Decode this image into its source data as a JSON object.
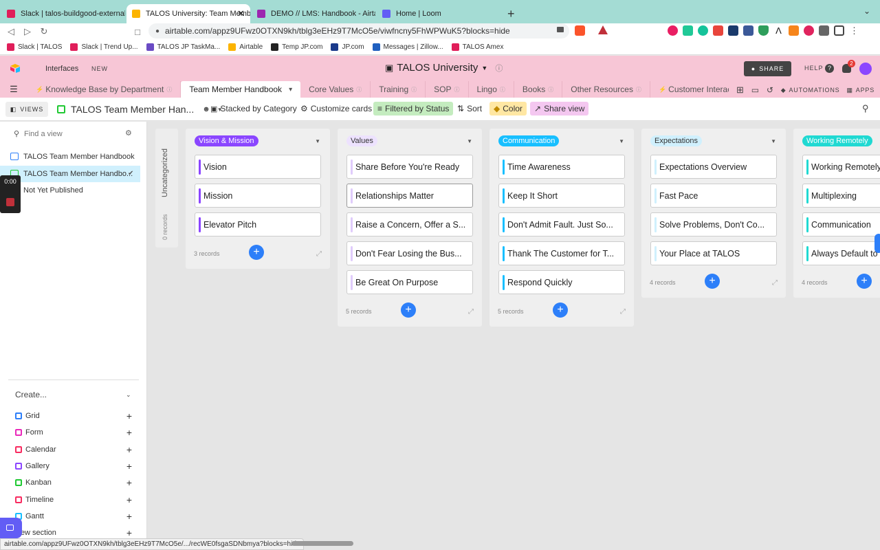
{
  "browser": {
    "tabs": [
      {
        "title": "Slack | talos-buildgood-external | T",
        "color": "#e01e5a"
      },
      {
        "title": "TALOS University: Team Membe",
        "color": "#fcb400"
      },
      {
        "title": "DEMO // LMS: Handbook - Airtable",
        "color": "#9c27b0"
      },
      {
        "title": "Home | Loom",
        "color": "#625df5"
      }
    ],
    "url": "airtable.com/appz9UFwz0OTXN9kh/tblg3eEHz9T7McO5e/viwfncny5FhWPWuK5?blocks=hide",
    "bookmarks": [
      "Slack | TALOS",
      "Slack | Trend Up...",
      "TALOS JP TaskMa...",
      "Airtable",
      "Temp JP.com",
      "JP.com",
      "Messages | Zillow...",
      "TALOS Amex"
    ],
    "status_url": "airtable.com/appz9UFwz0OTXN9kh/tblg3eEHz9T7McO5e/.../recWE0fsgaSDNbmya?blocks=hide"
  },
  "app": {
    "interfaces_label": "Interfaces",
    "new_badge": "NEW",
    "base_title": "TALOS University",
    "share_label": "SHARE",
    "help_label": "HELP",
    "notif_count": "2",
    "automations_label": "AUTOMATIONS",
    "apps_label": "APPS"
  },
  "tables": [
    "Knowledge Base by Department",
    "Team Member Handbook",
    "Core Values",
    "Training",
    "SOP",
    "Lingo",
    "Books",
    "Other Resources",
    "Customer Interactio"
  ],
  "toolbar": {
    "views_label": "VIEWS",
    "view_name": "TALOS Team Member Han...",
    "stacked": "Stacked by Category",
    "customize": "Customize cards",
    "filtered": "Filtered by Status",
    "sort": "Sort",
    "color": "Color",
    "share_view": "Share view"
  },
  "sidebar": {
    "find_placeholder": "Find a view",
    "views": [
      "TALOS Team Member Handbook",
      "TALOS Team Member Handbo...",
      "Not Yet Published"
    ],
    "create_label": "Create...",
    "create_items": [
      {
        "label": "Grid",
        "color": "#2d7ff9"
      },
      {
        "label": "Form",
        "color": "#e929ba"
      },
      {
        "label": "Calendar",
        "color": "#f82b60"
      },
      {
        "label": "Gallery",
        "color": "#8b46ff"
      },
      {
        "label": "Kanban",
        "color": "#20c933"
      },
      {
        "label": "Timeline",
        "color": "#f82b60"
      },
      {
        "label": "Gantt",
        "color": "#18bfff"
      },
      {
        "label": "New section",
        "color": ""
      }
    ],
    "recorder_time": "0:00"
  },
  "board": {
    "uncategorized_label": "Uncategorized",
    "uncategorized_count": "0 records",
    "columns": [
      {
        "name": "Vision & Mission",
        "pill_bg": "#8b46ff",
        "pill_fg": "#ffffff",
        "bar": "#8b46ff",
        "count": "3 records",
        "cards": [
          "Vision",
          "Mission",
          "Elevator Pitch"
        ]
      },
      {
        "name": "Values",
        "pill_bg": "#ede2fe",
        "pill_fg": "#333333",
        "bar": "#e0ccfb",
        "count": "5 records",
        "cards": [
          "Share Before You're Ready",
          "Relationships Matter",
          "Raise a Concern, Offer a S...",
          "Don't Fear Losing the Bus...",
          "Be Great On Purpose"
        ]
      },
      {
        "name": "Communication",
        "pill_bg": "#18bfff",
        "pill_fg": "#ffffff",
        "bar": "#18bfff",
        "count": "5 records",
        "cards": [
          "Time Awareness",
          "Keep It Short",
          "Don't Admit Fault. Just So...",
          "Thank The Customer for T...",
          "Respond Quickly"
        ]
      },
      {
        "name": "Expectations",
        "pill_bg": "#d0f0fd",
        "pill_fg": "#333333",
        "bar": "#d0f0fd",
        "count": "4 records",
        "cards": [
          "Expectations Overview",
          "Fast Pace",
          "Solve Problems, Don't Co...",
          "Your Place at TALOS"
        ]
      },
      {
        "name": "Working Remotely",
        "pill_bg": "#20d9d2",
        "pill_fg": "#ffffff",
        "bar": "#20d9d2",
        "count": "4 records",
        "cards": [
          "Working Remotely",
          "Multiplexing",
          "Communication",
          "Always Default to"
        ]
      }
    ]
  }
}
